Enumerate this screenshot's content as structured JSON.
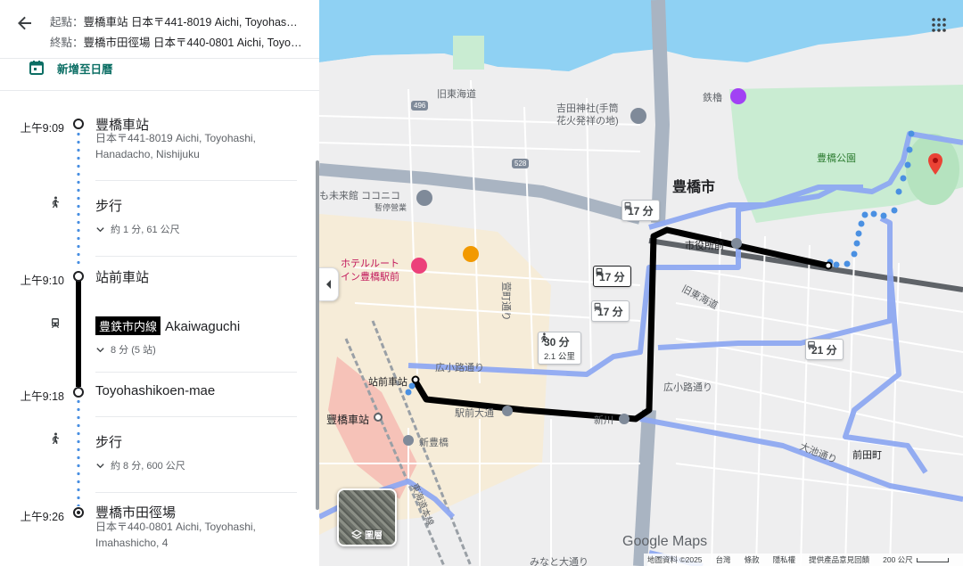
{
  "header": {
    "origin_prefix": "起點：",
    "origin_text": "豐橋車站 日本〒441-8019 Aichi, Toyohashi, Hanadacho, Nishijuku",
    "destination_prefix": "終點：",
    "destination_text": "豐橋市田徑場 日本〒440-0801 Aichi, Toyohashi, Imahashicho, 4",
    "calendar_label": "新增至日曆"
  },
  "itinerary": {
    "stop1": {
      "time": "上午9:09",
      "name": "豐橋車站",
      "address": "日本〒441-8019 Aichi, Toyohashi, Hanadacho, Nishijuku"
    },
    "walk1": {
      "title": "步行",
      "detail": "約 1 分, 61 公尺"
    },
    "stop2": {
      "time": "上午9:10",
      "name": "站前車站"
    },
    "transit": {
      "line_badge": "豊鉄市内線",
      "headsign": "Akaiwaguchi",
      "detail": "8 分 (5 站)"
    },
    "stop3": {
      "time": "上午9:18",
      "name": "Toyohashikoen-mae"
    },
    "walk2": {
      "title": "步行",
      "detail": "約 8 分, 600 公尺"
    },
    "stop4": {
      "time": "上午9:26",
      "name": "豐橋市田徑場",
      "address": "日本〒440-0801 Aichi, Toyohashi, Imahashicho, 4"
    }
  },
  "map": {
    "chips": {
      "c1": "17 分",
      "c2": "17 分",
      "c3": "17 分",
      "c4_time": "30 分",
      "c4_dist": "2.1 公里",
      "c5": "21 分"
    },
    "labels": {
      "kyu_tokaido": "旧東海道",
      "yoshida_shrine": "吉田神社(手筒\n花火発祥の地)",
      "tetsuyagura": "鉄櫓",
      "toyohashi_park": "豊橋公園",
      "toyohashi_city": "豊橋市",
      "mirai_kan": "も未来館 ココニコ",
      "mirai_sub": "暫停營業",
      "hotel_route": "ホテルルート",
      "hotel_route2": "イン豊橋駅前",
      "city_hall": "市役所前",
      "kyu_tokaido2": "旧東海道",
      "ekimae_stop": "站前車站",
      "toyohashi_station": "豐橋車站",
      "hirokoji": "広小路通り",
      "hirokoji2": "広小路通り",
      "ekimae_odori": "駅前大通",
      "shinkawa": "新川",
      "shin_toyohashi": "新豊橋",
      "oike_dori": "大池通り",
      "maeda_cho": "前田町",
      "minato_odori": "みなと大通り",
      "keimon": "萱町通り",
      "route_496": "496",
      "route_528": "528",
      "tokaido_line": "東海道本線"
    },
    "layers_label": "圖層",
    "logo": "Google Maps",
    "footer": {
      "copyright": "地圖資料 ©2025",
      "region": "台灣",
      "terms": "條款",
      "privacy": "隱私權",
      "feedback": "提供產品意見回饋",
      "scale": "200 公尺"
    }
  },
  "colors": {
    "accent": "#0b6e64",
    "walk_dot": "#4a90e2",
    "route_black": "#000000",
    "alt_route": "#8fa9f2",
    "water": "#8fd1f3",
    "park": "#c9ecd2",
    "pin": "#ea4335"
  }
}
